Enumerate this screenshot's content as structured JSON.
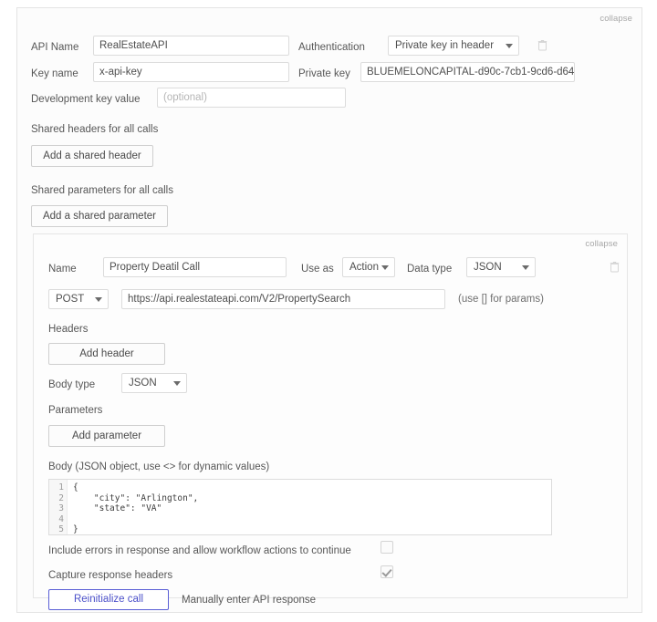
{
  "colors": {
    "accent": "#4b50c9",
    "card_bg": "#fcfcfc",
    "border": "#e4e4e4",
    "label_text": "#575757"
  },
  "api_card": {
    "collapse_label": "collapse",
    "fields": {
      "api_name_label": "API Name",
      "api_name_value": "RealEstateAPI",
      "key_name_label": "Key name",
      "key_name_value": "x-api-key",
      "dev_key_label": "Development key value",
      "dev_key_placeholder": "(optional)",
      "dev_key_value": "",
      "authentication_label": "Authentication",
      "authentication_value": "Private key in header",
      "private_key_label": "Private key",
      "private_key_value": "BLUEMELONCAPITAL-d90c-7cb1-9cd6-d64"
    },
    "shared_headers_label": "Shared headers for all calls",
    "add_shared_header_button": "Add a shared header",
    "shared_parameters_label": "Shared parameters for all calls",
    "add_shared_parameter_button": "Add a shared parameter",
    "delete_icon": "trash-icon"
  },
  "call_card": {
    "collapse_label": "collapse",
    "name_label": "Name",
    "name_value": "Property Deatil Call",
    "use_as_label": "Use as",
    "use_as_value": "Action",
    "data_type_label": "Data type",
    "data_type_value": "JSON",
    "method_value": "POST",
    "url_value": "https://api.realestateapi.com/V2/PropertySearch",
    "url_hint": "(use [] for params)",
    "headers_label": "Headers",
    "add_header_button": "Add header",
    "body_type_label": "Body type",
    "body_type_value": "JSON",
    "parameters_label": "Parameters",
    "add_parameter_button": "Add parameter",
    "body_label": "Body (JSON object, use <> for dynamic values)",
    "body_line_numbers": "1\n2\n3\n4\n5",
    "body_code": "{\n    \"city\": \"Arlington\",\n    \"state\": \"VA\"\n\n}",
    "include_errors_label": "Include errors in response and allow workflow actions to continue",
    "include_errors_checked": false,
    "capture_headers_label": "Capture response headers",
    "capture_headers_checked": true,
    "reinitialize_button": "Reinitialize call",
    "manual_response_label": "Manually enter API response",
    "delete_icon": "trash-icon"
  }
}
